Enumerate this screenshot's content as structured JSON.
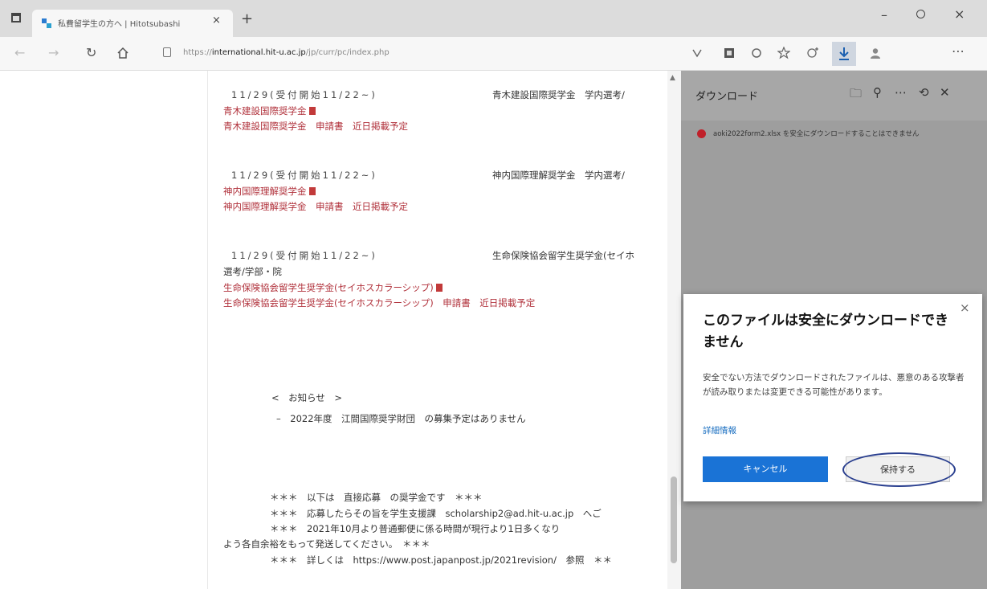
{
  "browser": {
    "tab_title": "私費留学生の方へ | Hitotsubashi",
    "tab_close": "×",
    "new_tab": "+",
    "url_prefix": "https://",
    "url_host": "international.hit-u.ac.jp",
    "url_path": "/jp/curr/pc/index.php",
    "win_min": "–",
    "win_close": "×"
  },
  "toolbar_icons": [
    "back-icon",
    "forward-icon",
    "refresh-icon",
    "home-icon",
    "lock-icon",
    "reading-icon",
    "collections-icon",
    "extension-icon",
    "favorites-icon",
    "add-favorite-icon",
    "download-icon",
    "profile-icon",
    "more-icon"
  ],
  "page": {
    "block1": {
      "date": "11/29(受付開始11/22~)",
      "title": "青木建設国際奨学金　学内選考/",
      "link1": "青木建設国際奨学金",
      "link2": "青木建設国際奨学金　申請書　近日掲載予定"
    },
    "block2": {
      "date": "11/29(受付開始11/22~)",
      "title": "神内国際理解奨学金　学内選考/",
      "link1": "神内国際理解奨学金",
      "link2": "神内国際理解奨学金　申請書　近日掲載予定"
    },
    "block3": {
      "date": "11/29(受付開始11/22~)",
      "title": "生命保険協会留学生奨学金(セイホ",
      "cont": "選考/学部・院",
      "link1": "生命保険協会留学生奨学金(セイホスカラーシップ)",
      "link2": "生命保険協会留学生奨学金(セイホスカラーシップ)　申請書　近日掲載予定"
    },
    "notice_heading": "<　お知らせ　>",
    "notice_item": "–　2022年度　江間国際奨学財団　の募集予定はありません",
    "bottom1": "＊＊＊　以下は　直接応募　の奨学金です　＊＊＊",
    "bottom2": "＊＊＊　応募したらその旨を学生支援課　scholarship2@ad.hit-u.ac.jp　へご",
    "bottom3": "＊＊＊　2021年10月より普通郵便に係る時間が現行より1日多くなり",
    "bottom4": "よう各自余裕をもって発送してください。　＊＊＊",
    "bottom5": "＊＊＊　詳しくは　https://www.post.japanpost.jp/2021revision/　参照　＊＊"
  },
  "download_panel": {
    "title": "ダウンロード",
    "item_message": "aoki2022form2.xlsx を安全にダウンロードすることはできません"
  },
  "popup": {
    "title": "このファイルは安全にダウンロードできません",
    "body": "安全でない方法でダウンロードされたファイルは、悪意のある攻撃者が読み取りまたは変更できる可能性があります。",
    "link": "詳細情報",
    "cancel": "キャンセル",
    "keep": "保持する",
    "close": "×"
  },
  "colors": {
    "accent": "#1a73d6",
    "link_red": "#b0303a",
    "error": "#c0202a",
    "annotation_oval": "#2a3f8f"
  }
}
